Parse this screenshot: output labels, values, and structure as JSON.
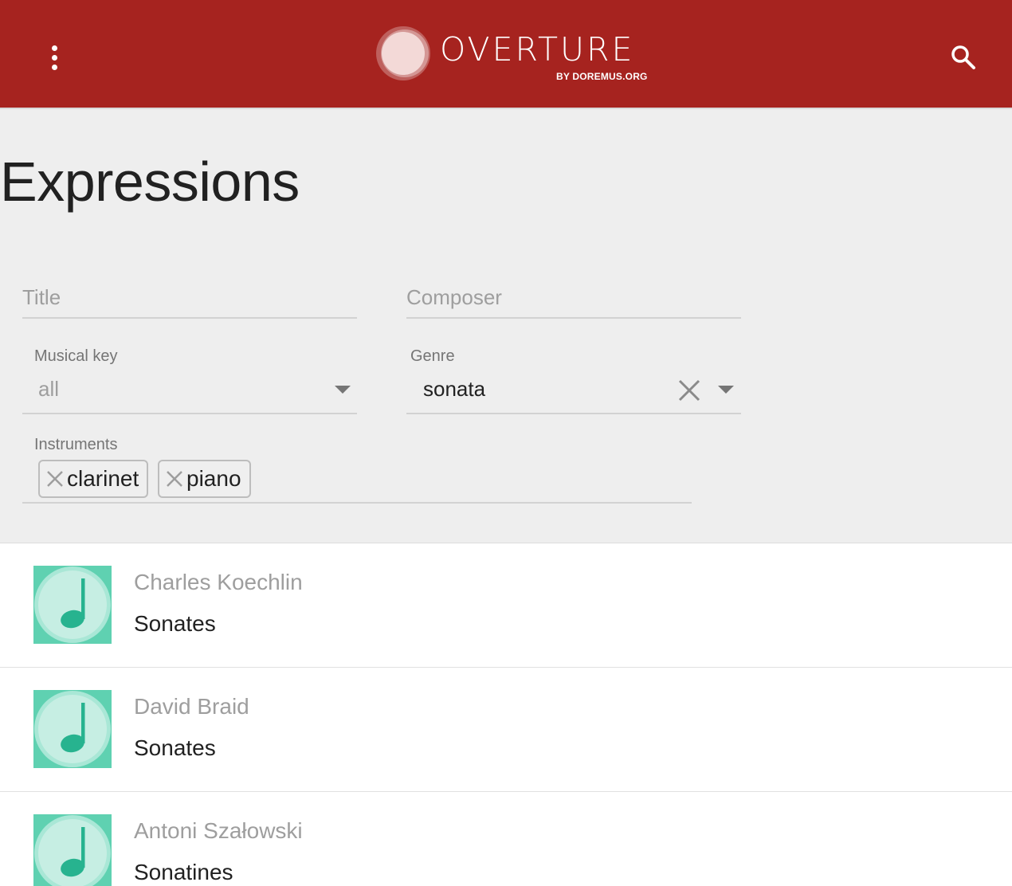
{
  "header": {
    "brand": "OVERTURE",
    "brand_sub": "BY DOREMUS.ORG",
    "menu_icon": "more-vert-icon",
    "search_icon": "search-icon",
    "bg_color": "#a6231f"
  },
  "page": {
    "title": "Expressions"
  },
  "filters": {
    "title": {
      "placeholder": "Title",
      "value": ""
    },
    "composer": {
      "placeholder": "Composer",
      "value": ""
    },
    "musical_key": {
      "label": "Musical key",
      "value": "all"
    },
    "genre": {
      "label": "Genre",
      "value": "sonata"
    },
    "instruments": {
      "label": "Instruments",
      "chips": [
        "clarinet",
        "piano"
      ]
    }
  },
  "results": [
    {
      "composer": "Charles Koechlin",
      "title": "Sonates"
    },
    {
      "composer": "David Braid",
      "title": "Sonates"
    },
    {
      "composer": "Antoni Szałowski",
      "title": "Sonatines"
    }
  ],
  "colors": {
    "thumb_bg": "#5fd1b1",
    "thumb_note": "#27b38f"
  }
}
